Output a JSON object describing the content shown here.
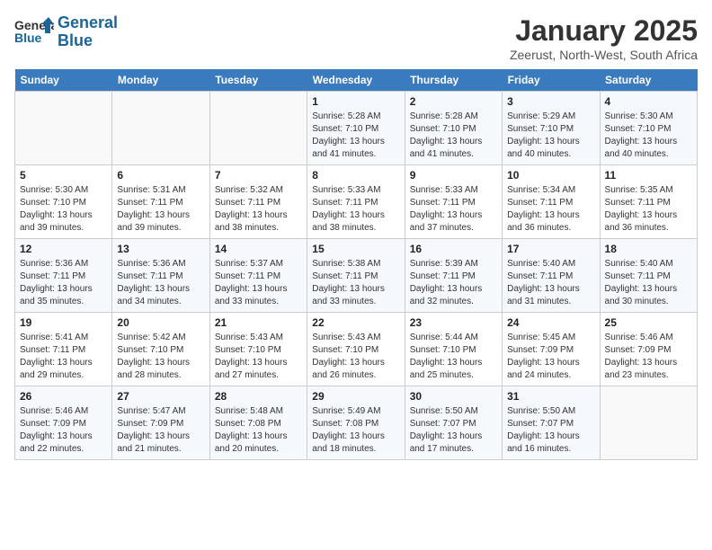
{
  "header": {
    "logo_line1": "General",
    "logo_line2": "Blue",
    "month": "January 2025",
    "location": "Zeerust, North-West, South Africa"
  },
  "weekdays": [
    "Sunday",
    "Monday",
    "Tuesday",
    "Wednesday",
    "Thursday",
    "Friday",
    "Saturday"
  ],
  "weeks": [
    [
      {
        "day": "",
        "info": ""
      },
      {
        "day": "",
        "info": ""
      },
      {
        "day": "",
        "info": ""
      },
      {
        "day": "1",
        "info": "Sunrise: 5:28 AM\nSunset: 7:10 PM\nDaylight: 13 hours and 41 minutes."
      },
      {
        "day": "2",
        "info": "Sunrise: 5:28 AM\nSunset: 7:10 PM\nDaylight: 13 hours and 41 minutes."
      },
      {
        "day": "3",
        "info": "Sunrise: 5:29 AM\nSunset: 7:10 PM\nDaylight: 13 hours and 40 minutes."
      },
      {
        "day": "4",
        "info": "Sunrise: 5:30 AM\nSunset: 7:10 PM\nDaylight: 13 hours and 40 minutes."
      }
    ],
    [
      {
        "day": "5",
        "info": "Sunrise: 5:30 AM\nSunset: 7:10 PM\nDaylight: 13 hours and 39 minutes."
      },
      {
        "day": "6",
        "info": "Sunrise: 5:31 AM\nSunset: 7:11 PM\nDaylight: 13 hours and 39 minutes."
      },
      {
        "day": "7",
        "info": "Sunrise: 5:32 AM\nSunset: 7:11 PM\nDaylight: 13 hours and 38 minutes."
      },
      {
        "day": "8",
        "info": "Sunrise: 5:33 AM\nSunset: 7:11 PM\nDaylight: 13 hours and 38 minutes."
      },
      {
        "day": "9",
        "info": "Sunrise: 5:33 AM\nSunset: 7:11 PM\nDaylight: 13 hours and 37 minutes."
      },
      {
        "day": "10",
        "info": "Sunrise: 5:34 AM\nSunset: 7:11 PM\nDaylight: 13 hours and 36 minutes."
      },
      {
        "day": "11",
        "info": "Sunrise: 5:35 AM\nSunset: 7:11 PM\nDaylight: 13 hours and 36 minutes."
      }
    ],
    [
      {
        "day": "12",
        "info": "Sunrise: 5:36 AM\nSunset: 7:11 PM\nDaylight: 13 hours and 35 minutes."
      },
      {
        "day": "13",
        "info": "Sunrise: 5:36 AM\nSunset: 7:11 PM\nDaylight: 13 hours and 34 minutes."
      },
      {
        "day": "14",
        "info": "Sunrise: 5:37 AM\nSunset: 7:11 PM\nDaylight: 13 hours and 33 minutes."
      },
      {
        "day": "15",
        "info": "Sunrise: 5:38 AM\nSunset: 7:11 PM\nDaylight: 13 hours and 33 minutes."
      },
      {
        "day": "16",
        "info": "Sunrise: 5:39 AM\nSunset: 7:11 PM\nDaylight: 13 hours and 32 minutes."
      },
      {
        "day": "17",
        "info": "Sunrise: 5:40 AM\nSunset: 7:11 PM\nDaylight: 13 hours and 31 minutes."
      },
      {
        "day": "18",
        "info": "Sunrise: 5:40 AM\nSunset: 7:11 PM\nDaylight: 13 hours and 30 minutes."
      }
    ],
    [
      {
        "day": "19",
        "info": "Sunrise: 5:41 AM\nSunset: 7:11 PM\nDaylight: 13 hours and 29 minutes."
      },
      {
        "day": "20",
        "info": "Sunrise: 5:42 AM\nSunset: 7:10 PM\nDaylight: 13 hours and 28 minutes."
      },
      {
        "day": "21",
        "info": "Sunrise: 5:43 AM\nSunset: 7:10 PM\nDaylight: 13 hours and 27 minutes."
      },
      {
        "day": "22",
        "info": "Sunrise: 5:43 AM\nSunset: 7:10 PM\nDaylight: 13 hours and 26 minutes."
      },
      {
        "day": "23",
        "info": "Sunrise: 5:44 AM\nSunset: 7:10 PM\nDaylight: 13 hours and 25 minutes."
      },
      {
        "day": "24",
        "info": "Sunrise: 5:45 AM\nSunset: 7:09 PM\nDaylight: 13 hours and 24 minutes."
      },
      {
        "day": "25",
        "info": "Sunrise: 5:46 AM\nSunset: 7:09 PM\nDaylight: 13 hours and 23 minutes."
      }
    ],
    [
      {
        "day": "26",
        "info": "Sunrise: 5:46 AM\nSunset: 7:09 PM\nDaylight: 13 hours and 22 minutes."
      },
      {
        "day": "27",
        "info": "Sunrise: 5:47 AM\nSunset: 7:09 PM\nDaylight: 13 hours and 21 minutes."
      },
      {
        "day": "28",
        "info": "Sunrise: 5:48 AM\nSunset: 7:08 PM\nDaylight: 13 hours and 20 minutes."
      },
      {
        "day": "29",
        "info": "Sunrise: 5:49 AM\nSunset: 7:08 PM\nDaylight: 13 hours and 18 minutes."
      },
      {
        "day": "30",
        "info": "Sunrise: 5:50 AM\nSunset: 7:07 PM\nDaylight: 13 hours and 17 minutes."
      },
      {
        "day": "31",
        "info": "Sunrise: 5:50 AM\nSunset: 7:07 PM\nDaylight: 13 hours and 16 minutes."
      },
      {
        "day": "",
        "info": ""
      }
    ]
  ]
}
